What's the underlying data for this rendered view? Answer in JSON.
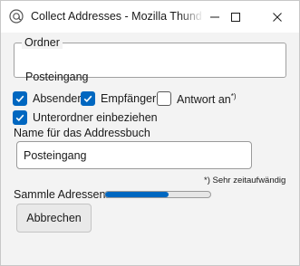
{
  "window": {
    "title": "Collect Addresses - Mozilla Thunderbird",
    "app_icon": "thunderbird-icon",
    "controls": [
      "minimize-icon",
      "maximize-icon",
      "close-icon"
    ]
  },
  "folder_group": {
    "legend": "Ordner",
    "value": "Posteingang"
  },
  "options": {
    "absender": {
      "label": "Absender",
      "checked": true
    },
    "empfaenger": {
      "label": "Empfänger",
      "checked": true
    },
    "antwort_an": {
      "label": "Antwort an",
      "marker": "*)",
      "checked": false
    },
    "unterordner": {
      "label": "Unterordner einbeziehen",
      "checked": true
    }
  },
  "addressbook": {
    "label": "Name für das Addressbuch",
    "value": "Posteingang"
  },
  "footnote": "*) Sehr zeitaufwändig",
  "progress": {
    "label": "Sammle Adressen:",
    "value": 0.6,
    "color": "#0067c0"
  },
  "cancel_label": "Abbrechen",
  "colors": {
    "accent": "#0067c0",
    "background": "#f3f3f3"
  }
}
